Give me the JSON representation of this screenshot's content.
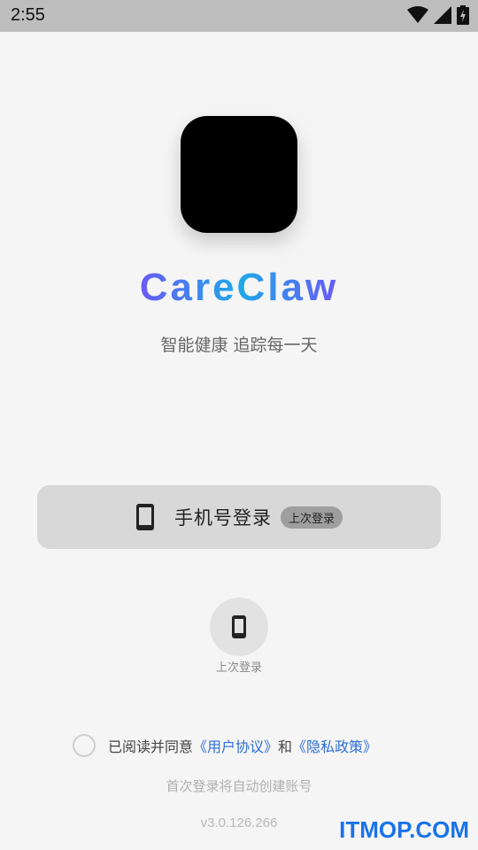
{
  "status_bar": {
    "time": "2:55",
    "icons": [
      "wifi-icon",
      "cell-signal-icon",
      "battery-charging-icon"
    ]
  },
  "app": {
    "name": "CareClaw",
    "tagline": "智能健康 追踪每一天",
    "gradient_colors": [
      "#6a5af5",
      "#1fa9e8"
    ]
  },
  "login": {
    "phone_label": "手机号登录",
    "last_badge": "上次登录",
    "alt_caption": "上次登录"
  },
  "agreement": {
    "prefix": "已阅读并同意",
    "user_agreement": "《用户协议》",
    "conjunction": "和",
    "privacy_policy": "《隐私政策》",
    "link_color": "#2f6fd6"
  },
  "footer": {
    "auto_note": "首次登录将自动创建账号",
    "version": "v3.0.126.266"
  },
  "watermark": {
    "text": "ITMOP.COM"
  }
}
